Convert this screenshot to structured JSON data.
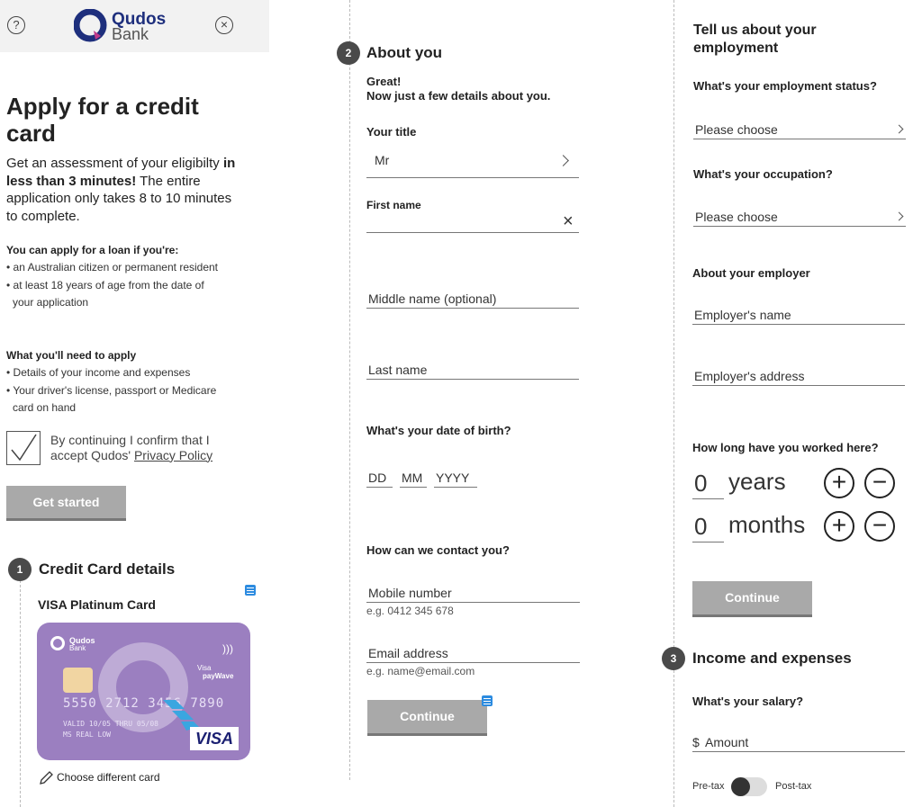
{
  "header": {
    "brand_name": "Qudos",
    "brand_sub": "Bank"
  },
  "intro": {
    "title": "Apply for a credit card",
    "lead_1": "Get an assessment of your eligibilty ",
    "lead_bold": "in less than 3 minutes!",
    "lead_2": " The entire application only takes 8 to 10 minutes to complete.",
    "eligibility_heading": "You can apply for a loan if you're:",
    "eligibility": [
      "an Australian citizen or permanent resident",
      "at least 18 years of age from the date of your application"
    ],
    "needs_heading": "What you'll need to apply",
    "needs": [
      "Details of your income and expenses",
      "Your driver's license, passport or Medicare card on hand"
    ],
    "confirm_text": "By continuing I confirm that I accept Qudos' ",
    "privacy_link": "Privacy Policy",
    "confirm_checked": true,
    "get_started": "Get started"
  },
  "step1": {
    "number": "1",
    "title": "Credit Card details",
    "card_name": "VISA Platinum Card",
    "card_brand": "Qudos",
    "card_brand_sub": "Bank",
    "card_visa_small": "Visa",
    "card_paywave": "payWave",
    "card_number": "5550 2712 3456 7890",
    "card_valid": "VALID 10/05  THRU 05/08",
    "card_holder": "MS REAL LOW",
    "card_logo": "VISA",
    "card_color": "#9b7fc0",
    "change_card": "Choose different card"
  },
  "step2": {
    "number": "2",
    "title": "About you",
    "greeting_1": "Great!",
    "greeting_2": "Now just a few details about you.",
    "title_label": "Your title",
    "title_value": "Mr",
    "first_name_label": "First name",
    "middle_name_placeholder": "Middle name (optional)",
    "last_name_placeholder": "Last name",
    "dob_question": "What's your date of birth?",
    "dob_dd": "DD",
    "dob_mm": "MM",
    "dob_yyyy": "YYYY",
    "contact_question": "How can we contact you?",
    "mobile_placeholder": "Mobile number",
    "mobile_hint": "e.g. 0412 345 678",
    "email_placeholder": "Email address",
    "email_hint": "e.g. name@email.com",
    "continue": "Continue"
  },
  "employment": {
    "heading": "Tell us about your employment",
    "status_question": "What's your employment status?",
    "status_value": "Please choose",
    "occupation_question": "What's your occupation?",
    "occupation_value": "Please choose",
    "employer_heading": "About your employer",
    "employer_name_placeholder": "Employer's name",
    "employer_address_placeholder": "Employer's address",
    "tenure_question": "How long have you worked here?",
    "years_value": "0",
    "years_unit": "years",
    "months_value": "0",
    "months_unit": "months",
    "continue": "Continue"
  },
  "step3": {
    "number": "3",
    "title": "Income and expenses",
    "salary_question": "What's your salary?",
    "currency": "$",
    "amount_placeholder": "Amount",
    "pretax": "Pre-tax",
    "posttax": "Post-tax"
  }
}
